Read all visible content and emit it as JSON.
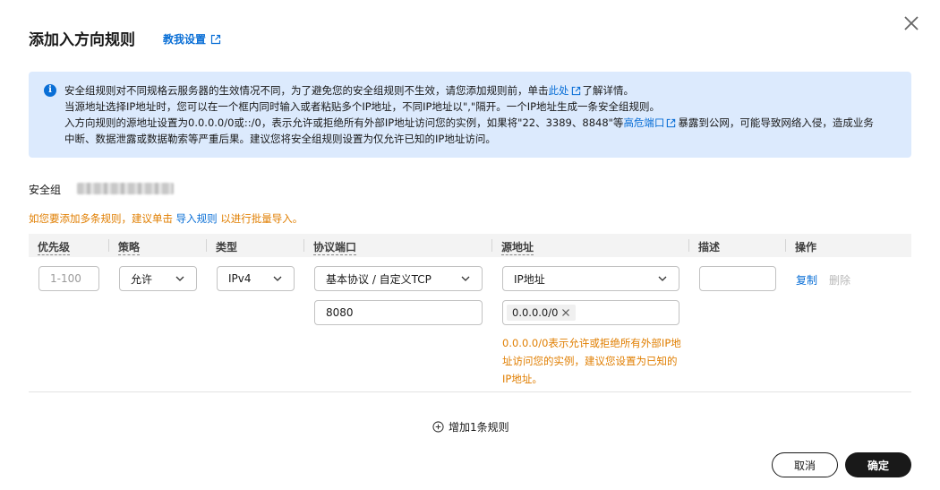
{
  "dialog": {
    "title": "添加入方向规则",
    "tutorial_link": "教我设置"
  },
  "info": {
    "line1_a": "安全组规则对不同规格云服务器的生效情况不同，为了避免您的安全组规则不生效，请您添加规则前，单击",
    "line1_link": "此处",
    "line1_b": "了解详情。",
    "line2": "当源地址选择IP地址时，您可以在一个框内同时输入或者粘贴多个IP地址，不同IP地址以\",\"隔开。一个IP地址生成一条安全组规则。",
    "line3_a": "入方向规则的源地址设置为0.0.0.0/0或::/0，表示允许或拒绝所有外部IP地址访问您的实例，如果将\"22、3389、8848\"等",
    "line3_link": "高危端口",
    "line3_b": "暴露到公网，可能导致网络入侵，造成业务",
    "line4": "中断、数据泄露或数据勒索等严重后果。建议您将安全组规则设置为仅允许已知的IP地址访问。"
  },
  "security_group": {
    "label": "安全组"
  },
  "hint": {
    "text_a": "如您要添加多条规则，建议单击",
    "link": "导入规则",
    "text_b": "以进行批量导入。"
  },
  "table": {
    "headers": [
      "优先级",
      "策略",
      "类型",
      "协议端口",
      "源地址",
      "描述",
      "操作"
    ]
  },
  "rule": {
    "priority_placeholder": "1-100",
    "policy": "允许",
    "type": "IPv4",
    "protocol": "基本协议 / 自定义TCP",
    "port": "8080",
    "source_type": "IP地址",
    "source_tag": "0.0.0.0/0",
    "source_warning": "0.0.0.0/0表示允许或拒绝所有外部IP地址访问您的实例，建议您设置为已知的IP地址。",
    "description": "",
    "op_copy": "复制",
    "op_delete": "删除"
  },
  "add_rule": "增加1条规则",
  "buttons": {
    "cancel": "取消",
    "ok": "确定"
  },
  "colors": {
    "link": "#0a6fd6",
    "warning": "#e07e00",
    "info_bg": "#dceafd",
    "primary_btn": "#191919"
  }
}
